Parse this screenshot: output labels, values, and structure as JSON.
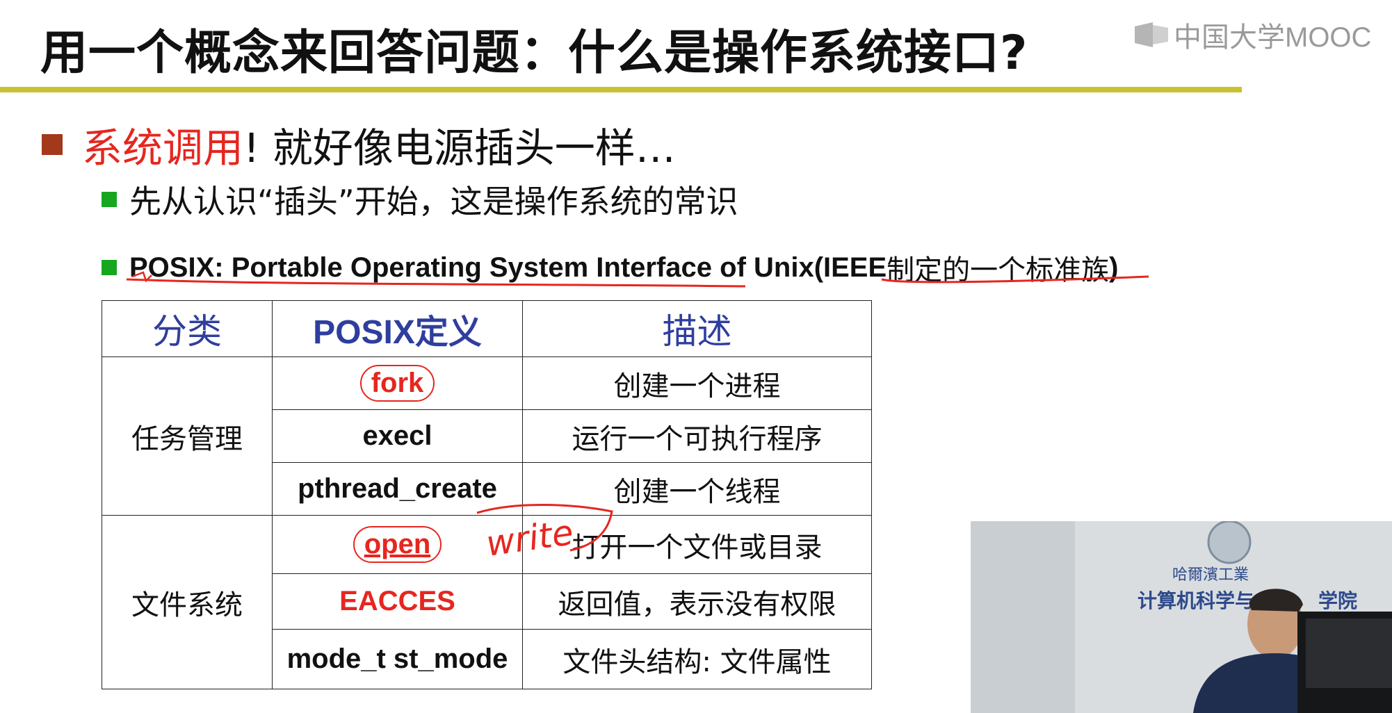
{
  "title": "用一个概念来回答问题：什么是操作系统接口?",
  "watermark": {
    "text": "中国大学MOOC",
    "icon": "mooc-logo-icon"
  },
  "bullet1": {
    "highlight": "系统调用",
    "rest": "! 就好像电源插头一样…"
  },
  "bullet2": "先从认识“插头”开始，这是操作系统的常识",
  "bullet3": {
    "en": "POSIX: Portable Operating System Interface of Unix(IEEE",
    "cn": "制定的一个标准族",
    "close": ")"
  },
  "table": {
    "headers": [
      "分类",
      "POSIX定义",
      "描述"
    ],
    "groups": [
      {
        "category": "任务管理",
        "rows": [
          {
            "fn": "fork",
            "desc": "创建一个进程"
          },
          {
            "fn": "execl",
            "desc": "运行一个可执行程序"
          },
          {
            "fn": "pthread_create",
            "desc": "创建一个线程"
          }
        ]
      },
      {
        "category": "文件系统",
        "rows": [
          {
            "fn": "open",
            "desc": "打开一个文件或目录"
          },
          {
            "fn": "EACCES",
            "desc": "返回值，表示没有权限"
          },
          {
            "fn": "mode_t st_mode",
            "desc": "文件头结构: 文件属性"
          }
        ]
      }
    ]
  },
  "handwriting": {
    "text": "write"
  },
  "video": {
    "banner_top": "哈爾濱工業",
    "banner_main": "计算机科学与",
    "banner_suffix": "学院",
    "emblem": "university-emblem-icon"
  },
  "colors": {
    "accent_red": "#e6261f",
    "header_blue": "#2f3e9e",
    "rule": "#c9c22f",
    "bullet_red": "#a3381a",
    "bullet_green": "#17a61f"
  }
}
